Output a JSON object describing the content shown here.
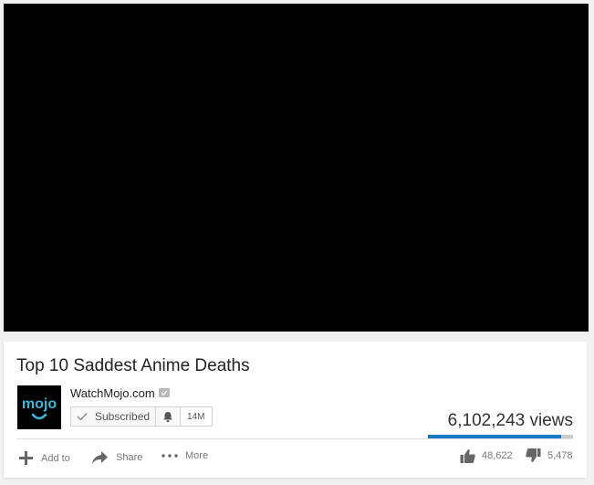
{
  "video": {
    "title": "Top 10 Saddest Anime Deaths",
    "views": "6,102,243 views",
    "like_ratio": 0.918
  },
  "channel": {
    "name": "WatchMojo.com",
    "logo_text": "mojo",
    "subscribe_label": "Subscribed",
    "subscriber_count": "14M",
    "icons": [
      "verified-icon",
      "check-icon",
      "bell-icon"
    ]
  },
  "actions": {
    "add_to_label": "Add to",
    "share_label": "Share",
    "more_label": "More"
  },
  "ratings": {
    "likes": "48,622",
    "dislikes": "5,478"
  },
  "colors": {
    "accent": "#167ac6",
    "logo": "#3fb6d8",
    "player": "#000000"
  }
}
